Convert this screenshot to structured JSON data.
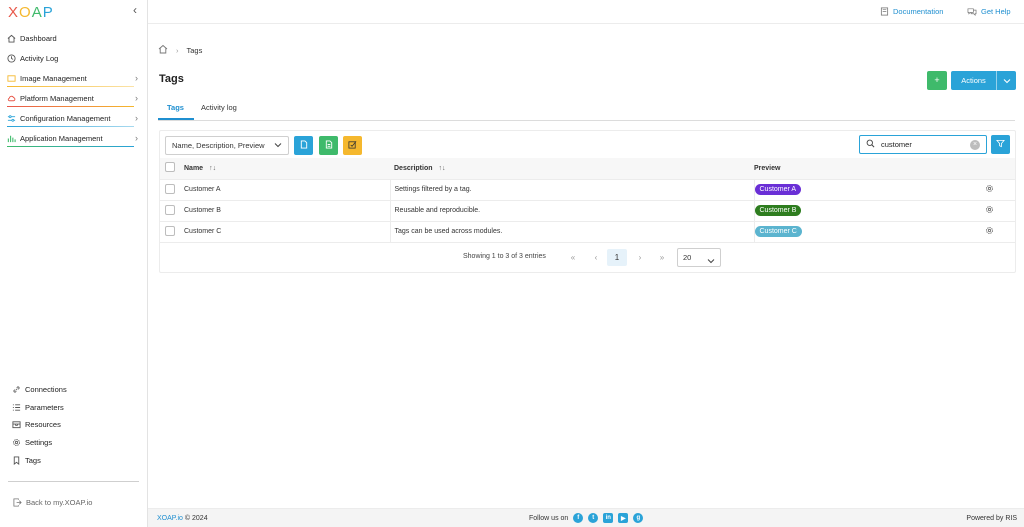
{
  "app": {
    "logo_text": "XOAP",
    "colors": {
      "accent": "#1f8fd0",
      "primary_button": "#2aa3d8",
      "green_button": "#3fba6b",
      "yellow_button": "#f5b82e"
    }
  },
  "sidebar": {
    "items": [
      {
        "label": "Dashboard",
        "icon": "home-icon",
        "has_children": false,
        "bar_color": ""
      },
      {
        "label": "Activity Log",
        "icon": "clock-icon",
        "has_children": false,
        "bar_color": ""
      },
      {
        "label": "Image Management",
        "icon": "image-icon",
        "has_children": true,
        "bar_color": "#f5b82e"
      },
      {
        "label": "Platform Management",
        "icon": "cloud-icon",
        "has_children": true,
        "bar_color": "#e8584a"
      },
      {
        "label": "Configuration Management",
        "icon": "sliders-icon",
        "has_children": true,
        "bar_color": "#2aa3d8"
      },
      {
        "label": "Application Management",
        "icon": "chart-icon",
        "has_children": true,
        "bar_color": "#3fba6b"
      }
    ],
    "bottom_items": [
      {
        "label": "Connections",
        "icon": "link-icon"
      },
      {
        "label": "Parameters",
        "icon": "list-icon"
      },
      {
        "label": "Resources",
        "icon": "box-icon"
      },
      {
        "label": "Settings",
        "icon": "gear-icon"
      },
      {
        "label": "Tags",
        "icon": "bookmark-icon"
      }
    ],
    "back_label": "Back to my.XOAP.io"
  },
  "topbar": {
    "documentation_label": "Documentation",
    "help_label": "Get Help"
  },
  "breadcrumb": {
    "current": "Tags"
  },
  "page": {
    "title": "Tags",
    "plus_label": "+",
    "actions_label": "Actions"
  },
  "tabs": [
    {
      "label": "Tags",
      "active": true
    },
    {
      "label": "Activity log",
      "active": false
    }
  ],
  "toolbar": {
    "columns_value": "Name, Description, Preview",
    "search_value": "customer"
  },
  "table": {
    "headers": {
      "name": "Name",
      "description": "Description",
      "preview": "Preview"
    },
    "rows": [
      {
        "name": "Customer A",
        "description": "Settings filtered by a tag.",
        "preview": "Customer A",
        "preview_color": "#6a2fd6"
      },
      {
        "name": "Customer B",
        "description": "Reusable and reproducible.",
        "preview": "Customer B",
        "preview_color": "#2e7d1f"
      },
      {
        "name": "Customer C",
        "description": "Tags can be used across modules.",
        "preview": "Customer C",
        "preview_color": "#5bb4cf"
      }
    ]
  },
  "pagination": {
    "info": "Showing 1 to 3 of 3 entries",
    "current_page": "1",
    "rows_per_page": "20"
  },
  "footer": {
    "brand": "XOAP.io",
    "copyright": "© 2024",
    "follow_label": "Follow us on",
    "powered": "Powered by RIS"
  }
}
